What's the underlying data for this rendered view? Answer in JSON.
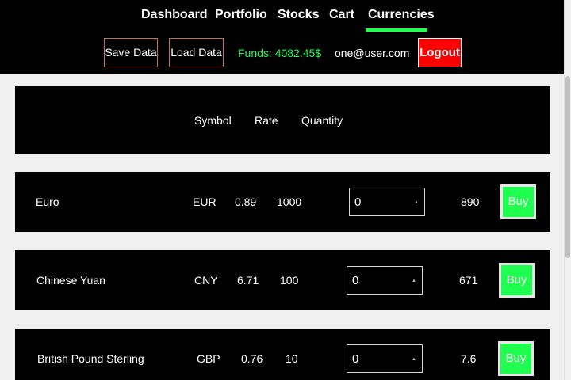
{
  "nav": {
    "items": [
      {
        "label": "Dashboard"
      },
      {
        "label": "Portfolio"
      },
      {
        "label": "Stocks"
      },
      {
        "label": "Cart"
      },
      {
        "label": "Currencies",
        "active": true
      }
    ]
  },
  "header": {
    "save_label": "Save Data",
    "load_label": "Load Data",
    "funds": "Funds: 4082.45$",
    "email": "one@user.com",
    "logout_label": "Logout"
  },
  "columns": {
    "symbol": "Symbol",
    "rate": "Rate",
    "quantity": "Quantity"
  },
  "rows": [
    {
      "name": "Euro",
      "symbol": "EUR",
      "rate": "0.89",
      "quantity": "1000",
      "input_value": "0",
      "total": "890",
      "buy_label": "Buy"
    },
    {
      "name": "Chinese Yuan",
      "symbol": "CNY",
      "rate": "6.71",
      "quantity": "100",
      "input_value": "0",
      "total": "671",
      "buy_label": "Buy"
    },
    {
      "name": "British Pound Sterling",
      "symbol": "GBP",
      "rate": "0.76",
      "quantity": "10",
      "input_value": "0",
      "total": "7.6",
      "buy_label": "Buy"
    }
  ],
  "colors": {
    "accent": "#1eff50",
    "logout": "#ff0000",
    "header_bg": "#000000",
    "page_bg": "#f0f0f0",
    "button_border": "#c8743a"
  },
  "icons": {
    "spinner": "number-spinner-icon"
  }
}
